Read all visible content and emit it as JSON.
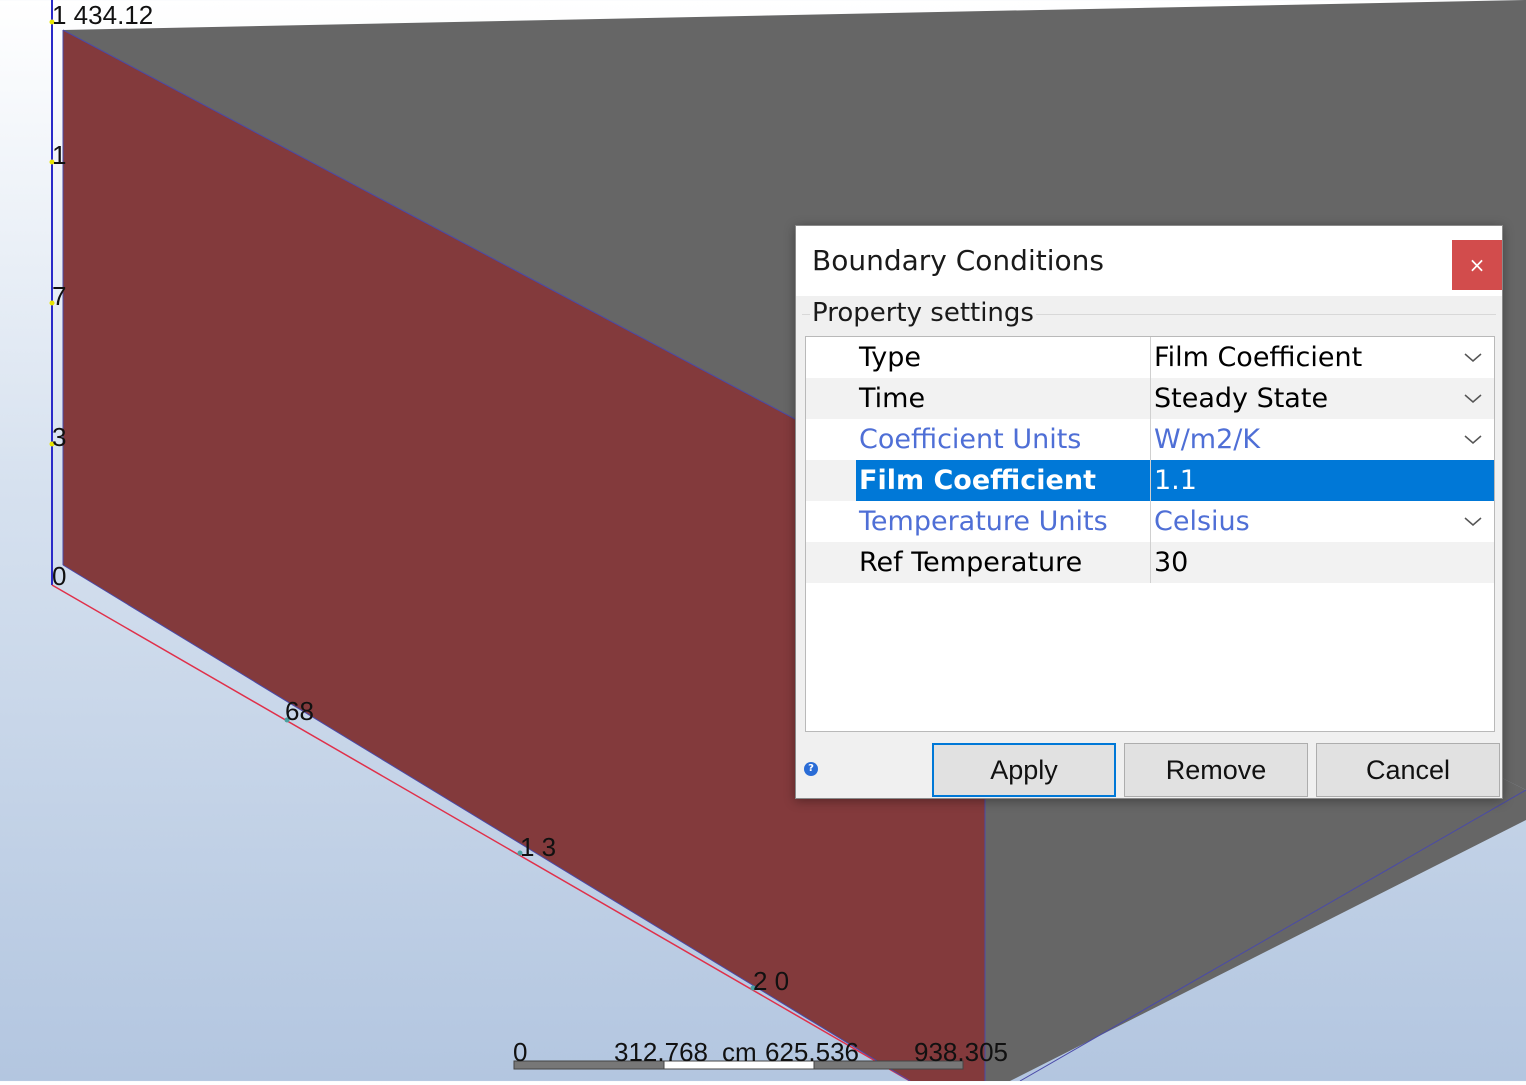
{
  "viewport": {
    "background_color": "#c8d6e9",
    "wall_color": "#833a3c",
    "box_color": "#666666",
    "z_axis": {
      "top_label": "1 434.12",
      "tick_labels": [
        "1",
        "7",
        "3",
        "0"
      ]
    },
    "x_axis": {
      "tick_labels": [
        "68",
        "1 3",
        "2 0"
      ]
    },
    "scale_bar": {
      "labels": [
        "0",
        "312.768",
        "cm",
        "625.536",
        "938.305"
      ]
    }
  },
  "dialog": {
    "title": "Boundary Conditions",
    "close_label": "×",
    "group_label": "Property settings",
    "selection_color": "#0078d7",
    "rows": [
      {
        "name": "Type",
        "value": "Film Coefficient",
        "dropdown": true
      },
      {
        "name": "Time",
        "value": "Steady State",
        "dropdown": true
      },
      {
        "name": "Coefficient Units",
        "value": "W/m2/K",
        "dropdown": true
      },
      {
        "name": "Film Coefficient",
        "value": "1.1",
        "dropdown": false
      },
      {
        "name": "Temperature Units",
        "value": "Celsius",
        "dropdown": true
      },
      {
        "name": "Ref Temperature",
        "value": "30",
        "dropdown": false
      }
    ],
    "help_icon": "help-icon",
    "buttons": {
      "apply": "Apply",
      "remove": "Remove",
      "cancel": "Cancel"
    }
  }
}
